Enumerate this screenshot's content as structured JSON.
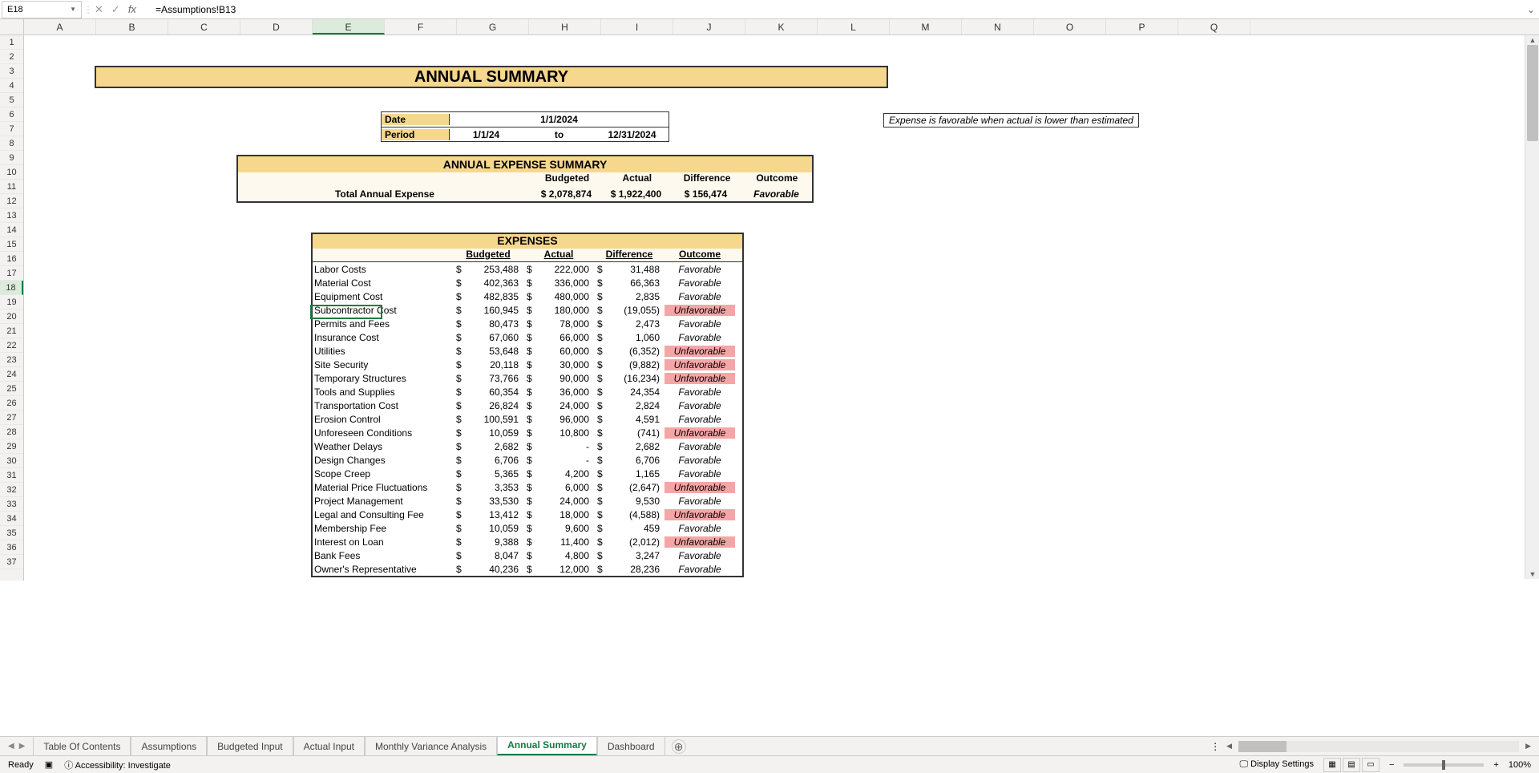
{
  "name_box": "E18",
  "formula": "=Assumptions!B13",
  "columns": [
    "A",
    "B",
    "C",
    "D",
    "E",
    "F",
    "G",
    "H",
    "I",
    "J",
    "K",
    "L",
    "M",
    "N",
    "O",
    "P",
    "Q"
  ],
  "selected_col": "E",
  "selected_row": 18,
  "rows": [
    1,
    2,
    3,
    4,
    5,
    6,
    7,
    8,
    9,
    10,
    11,
    12,
    13,
    14,
    15,
    16,
    17,
    18,
    19,
    20,
    21,
    22,
    23,
    24,
    25,
    26,
    27,
    28,
    29,
    30,
    31,
    32,
    33,
    34,
    35,
    36,
    37
  ],
  "title": "ANNUAL SUMMARY",
  "date_label": "Date",
  "date_value": "1/1/2024",
  "period_label": "Period",
  "period_from": "1/1/24",
  "period_to_word": "to",
  "period_to": "12/31/2024",
  "note": "Expense is favorable when actual is lower than estimated",
  "summary": {
    "title": "ANNUAL EXPENSE SUMMARY",
    "headers": [
      "Budgeted",
      "Actual",
      "Difference",
      "Outcome"
    ],
    "row_label": "Total Annual Expense",
    "budgeted": "$ 2,078,874",
    "actual": "$ 1,922,400",
    "difference": "$    156,474",
    "outcome": "Favorable"
  },
  "expenses": {
    "title": "EXPENSES",
    "headers": [
      "Budgeted",
      "Actual",
      "Difference",
      "Outcome"
    ],
    "rows": [
      {
        "label": "Labor Costs",
        "b": "253,488",
        "a": "222,000",
        "d": "31,488",
        "o": "Favorable",
        "u": false
      },
      {
        "label": "Material Cost",
        "b": "402,363",
        "a": "336,000",
        "d": "66,363",
        "o": "Favorable",
        "u": false
      },
      {
        "label": "Equipment Cost",
        "b": "482,835",
        "a": "480,000",
        "d": "2,835",
        "o": "Favorable",
        "u": false
      },
      {
        "label": "Subcontractor Cost",
        "b": "160,945",
        "a": "180,000",
        "d": "(19,055)",
        "o": "Unfavorable",
        "u": true
      },
      {
        "label": "Permits and Fees",
        "b": "80,473",
        "a": "78,000",
        "d": "2,473",
        "o": "Favorable",
        "u": false
      },
      {
        "label": "Insurance Cost",
        "b": "67,060",
        "a": "66,000",
        "d": "1,060",
        "o": "Favorable",
        "u": false
      },
      {
        "label": "Utilities",
        "b": "53,648",
        "a": "60,000",
        "d": "(6,352)",
        "o": "Unfavorable",
        "u": true
      },
      {
        "label": "Site Security",
        "b": "20,118",
        "a": "30,000",
        "d": "(9,882)",
        "o": "Unfavorable",
        "u": true
      },
      {
        "label": "Temporary Structures",
        "b": "73,766",
        "a": "90,000",
        "d": "(16,234)",
        "o": "Unfavorable",
        "u": true
      },
      {
        "label": "Tools and Supplies",
        "b": "60,354",
        "a": "36,000",
        "d": "24,354",
        "o": "Favorable",
        "u": false
      },
      {
        "label": "Transportation Cost",
        "b": "26,824",
        "a": "24,000",
        "d": "2,824",
        "o": "Favorable",
        "u": false
      },
      {
        "label": "Erosion Control",
        "b": "100,591",
        "a": "96,000",
        "d": "4,591",
        "o": "Favorable",
        "u": false
      },
      {
        "label": "Unforeseen Conditions",
        "b": "10,059",
        "a": "10,800",
        "d": "(741)",
        "o": "Unfavorable",
        "u": true
      },
      {
        "label": "Weather Delays",
        "b": "2,682",
        "a": "-",
        "d": "2,682",
        "o": "Favorable",
        "u": false
      },
      {
        "label": "Design Changes",
        "b": "6,706",
        "a": "-",
        "d": "6,706",
        "o": "Favorable",
        "u": false
      },
      {
        "label": "Scope Creep",
        "b": "5,365",
        "a": "4,200",
        "d": "1,165",
        "o": "Favorable",
        "u": false
      },
      {
        "label": "Material Price Fluctuations",
        "b": "3,353",
        "a": "6,000",
        "d": "(2,647)",
        "o": "Unfavorable",
        "u": true
      },
      {
        "label": "Project Management",
        "b": "33,530",
        "a": "24,000",
        "d": "9,530",
        "o": "Favorable",
        "u": false
      },
      {
        "label": "Legal and Consulting Fee",
        "b": "13,412",
        "a": "18,000",
        "d": "(4,588)",
        "o": "Unfavorable",
        "u": true
      },
      {
        "label": "Membership Fee",
        "b": "10,059",
        "a": "9,600",
        "d": "459",
        "o": "Favorable",
        "u": false
      },
      {
        "label": "Interest on Loan",
        "b": "9,388",
        "a": "11,400",
        "d": "(2,012)",
        "o": "Unfavorable",
        "u": true
      },
      {
        "label": "Bank Fees",
        "b": "8,047",
        "a": "4,800",
        "d": "3,247",
        "o": "Favorable",
        "u": false
      },
      {
        "label": "Owner's Representative",
        "b": "40,236",
        "a": "12,000",
        "d": "28,236",
        "o": "Favorable",
        "u": false
      }
    ]
  },
  "tabs": [
    "Table Of Contents",
    "Assumptions",
    "Budgeted Input",
    "Actual Input",
    "Monthly Variance Analysis",
    "Annual Summary",
    "Dashboard"
  ],
  "active_tab": "Annual Summary",
  "status": {
    "ready": "Ready",
    "accessibility": "Accessibility: Investigate",
    "display": "Display Settings",
    "zoom": "100%"
  }
}
